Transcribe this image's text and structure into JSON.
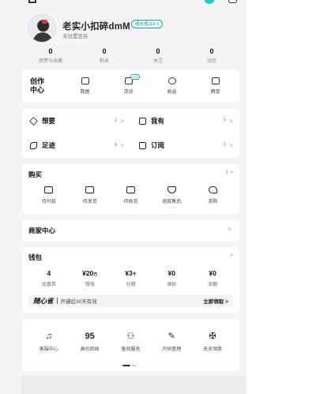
{
  "profile": {
    "username": "老实小扣碎dmM",
    "growth_badge": "成长值118 >",
    "signature": "未设置签名"
  },
  "stats": [
    {
      "value": "0",
      "label": "获赞与收藏"
    },
    {
      "value": "0",
      "label": "粉丝"
    },
    {
      "value": "0",
      "label": "关注"
    },
    {
      "value": "0",
      "label": "动态"
    }
  ],
  "creator": {
    "title_line1": "创作",
    "title_line2": "中心",
    "live_tag": "LIVE",
    "items": [
      {
        "label": "数据",
        "icon": "chart-icon"
      },
      {
        "label": "活动",
        "icon": "flag-icon"
      },
      {
        "label": "收益",
        "icon": "coin-icon"
      },
      {
        "label": "晒单",
        "icon": "pen-icon"
      }
    ]
  },
  "shortcuts": [
    {
      "label": "想要",
      "count": "2",
      "icon": "star-icon"
    },
    {
      "label": "我有",
      "count": "0",
      "icon": "wallet-icon"
    },
    {
      "label": "足迹",
      "count": "6",
      "icon": "footprint-icon"
    },
    {
      "label": "订阅",
      "count": "0",
      "icon": "plus-icon"
    }
  ],
  "purchase": {
    "title": "购买",
    "count": "1",
    "items": [
      {
        "label": "待付款",
        "icon": "card-icon"
      },
      {
        "label": "待发货",
        "icon": "box-icon"
      },
      {
        "label": "待收货",
        "icon": "truck-icon"
      },
      {
        "label": "退款售后",
        "icon": "shield-icon"
      },
      {
        "label": "求购",
        "icon": "heart-plus-icon"
      }
    ]
  },
  "merchant": {
    "title": "商家中心"
  },
  "wallet": {
    "title": "钱包",
    "items": [
      {
        "value": "4",
        "unit": "",
        "label": "优惠券"
      },
      {
        "value": "¥20",
        "unit": "万",
        "label": "借钱"
      },
      {
        "value": "¥3",
        "unit": "千",
        "label": "分期"
      },
      {
        "value": "¥0",
        "unit": "",
        "label": "津贴"
      },
      {
        "value": "¥0",
        "unit": "",
        "label": "余额"
      }
    ],
    "promo": {
      "brand": "随心省",
      "text": "开通后30天有效",
      "action": "立即领取 >"
    }
  },
  "services": [
    {
      "label": "客服中心",
      "icon": "headset-icon",
      "glyph": "♫"
    },
    {
      "label": "高价回收",
      "icon": "recycle-95-icon",
      "glyph": "95"
    },
    {
      "label": "鉴别服务",
      "icon": "inspector-icon",
      "glyph": "⚇"
    },
    {
      "label": "尺码管理",
      "icon": "ruler-icon",
      "glyph": "✎"
    },
    {
      "label": "天天领券",
      "icon": "ticket-icon",
      "glyph": "✠"
    }
  ],
  "chevron": ">"
}
